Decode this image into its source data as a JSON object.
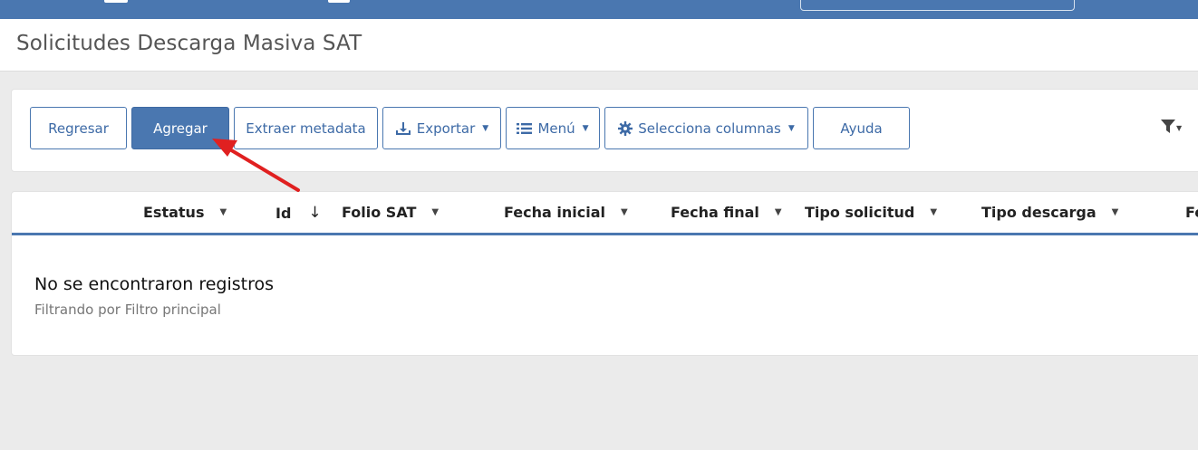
{
  "page": {
    "title": "Solicitudes Descarga Masiva SAT"
  },
  "toolbar": {
    "back_label": "Regresar",
    "add_label": "Agregar",
    "extract_label": "Extraer metadata",
    "export_label": "Exportar",
    "menu_label": "Menú",
    "columns_label": "Selecciona columnas",
    "help_label": "Ayuda"
  },
  "table": {
    "columns": [
      "Estatus",
      "Id",
      "Folio SAT",
      "Fecha inicial",
      "Fecha final",
      "Tipo solicitud",
      "Tipo descarga",
      "Fe"
    ],
    "empty_message": "No se encontraron registros",
    "filter_note": "Filtrando por Filtro principal"
  },
  "icons": {
    "export": "download-icon",
    "menu": "list-icon",
    "columns": "gear-icon",
    "filter": "filter-icon",
    "sort_desc": "arrow-down-icon",
    "annotation": "red-arrow-icon"
  },
  "colors": {
    "header_blue": "#4a77b0",
    "primary_button": "#4a77b0",
    "annotation_red": "#e02020",
    "background": "#ebebeb"
  }
}
